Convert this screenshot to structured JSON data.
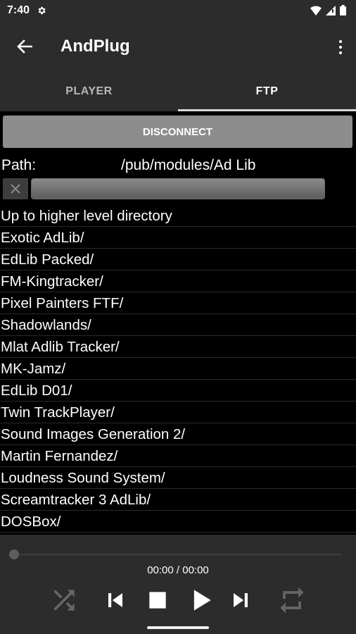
{
  "status_bar": {
    "time": "7:40"
  },
  "app_bar": {
    "title": "AndPlug"
  },
  "tabs": [
    {
      "label": "PLAYER",
      "active": false
    },
    {
      "label": "FTP",
      "active": true
    }
  ],
  "ftp": {
    "disconnect_label": "DISCONNECT",
    "path_label": "Path:",
    "path_value": "/pub/modules/Ad Lib",
    "filter_value": ""
  },
  "files": [
    "Up to higher level directory",
    "Exotic AdLib/",
    "EdLib Packed/",
    "FM-Kingtracker/",
    "Pixel Painters FTF/",
    "Shadowlands/",
    "Mlat Adlib Tracker/",
    "MK-Jamz/",
    "EdLib D01/",
    "Twin TrackPlayer/",
    "Sound Images Generation 2/",
    "Martin Fernandez/",
    "Loudness Sound System/",
    "Screamtracker 3 AdLib/",
    "DOSBox/"
  ],
  "player": {
    "time": "00:00 / 00:00",
    "progress": 0
  },
  "colors": {
    "bar_background": "#2c2c2c",
    "list_background": "#000000",
    "button_gray": "#8d8d8d",
    "inactive_icon": "#666666"
  }
}
